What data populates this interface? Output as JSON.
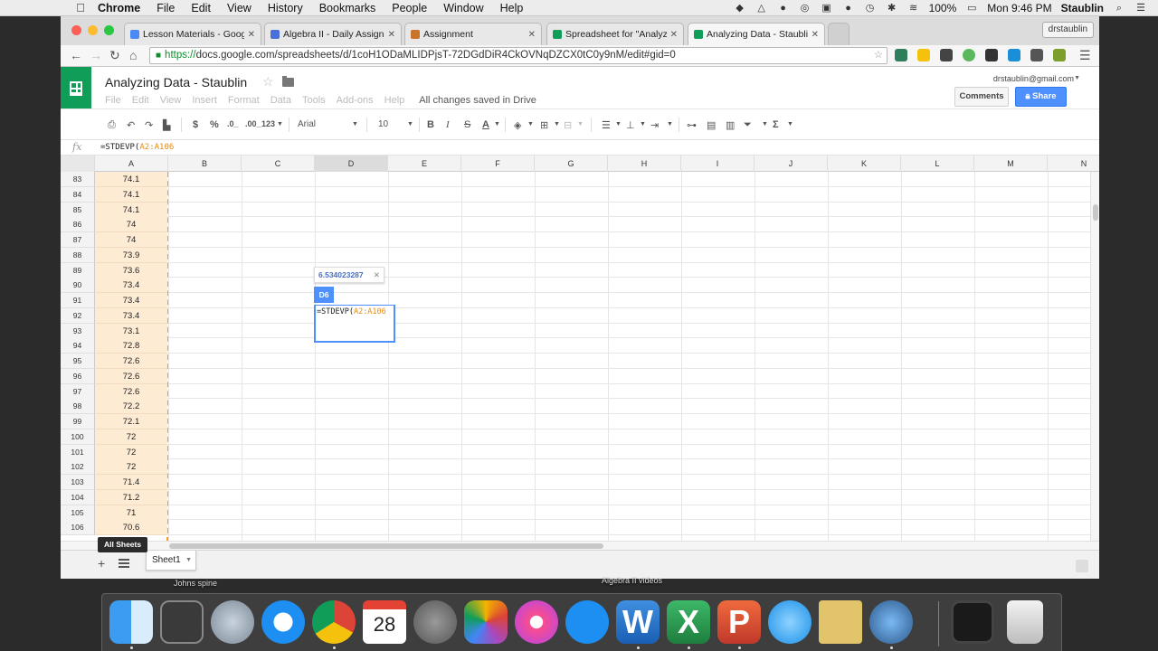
{
  "menubar": {
    "app": "Chrome",
    "items": [
      "File",
      "Edit",
      "View",
      "History",
      "Bookmarks",
      "People",
      "Window",
      "Help"
    ],
    "battery": "100%",
    "clock": "Mon 9:46 PM",
    "user": "Staublin"
  },
  "browser": {
    "tabs": [
      {
        "title": "Lesson Materials - Google",
        "favicon_color": "#4a8af4"
      },
      {
        "title": "Algebra II - Daily Assignme",
        "favicon_color": "#4a6fd8"
      },
      {
        "title": "Assignment",
        "favicon_color": "#c8742a"
      },
      {
        "title": "Spreadsheet for \"Analyzing",
        "favicon_color": "#0f9d58"
      },
      {
        "title": "Analyzing Data - Staublin -",
        "favicon_color": "#0f9d58"
      }
    ],
    "profile": "drstaublin",
    "url_scheme": "https://",
    "url_rest": "docs.google.com/spreadsheets/d/1coH1ODaMLIDPjsT-72DGdDiR4CkOVNqDZCX0tC0y9nM/edit#gid=0"
  },
  "doc": {
    "title": "Analyzing Data - Staublin",
    "menus": [
      "File",
      "Edit",
      "View",
      "Insert",
      "Format",
      "Data",
      "Tools",
      "Add-ons",
      "Help"
    ],
    "save_status": "All changes saved in Drive",
    "account": "drstaublin@gmail.com",
    "comments_label": "Comments",
    "share_label": "Share"
  },
  "toolbar": {
    "currency": "$",
    "percent": "%",
    "dec_less": ".0_",
    "dec_more": ".00_",
    "number_format": "123",
    "font": "Arial",
    "font_size": "10",
    "bold": "B",
    "italic": "I",
    "strike": "S",
    "text_color": "A",
    "functions": "Σ"
  },
  "formula_bar": {
    "fx": "fx",
    "prefix": "=STDEVP(",
    "range": "A2:A106"
  },
  "grid": {
    "columns": [
      "A",
      "B",
      "C",
      "D",
      "E",
      "F",
      "G",
      "H",
      "I",
      "J",
      "K",
      "L",
      "M",
      "N"
    ],
    "selected_column": "D",
    "rows": [
      {
        "n": "83",
        "a": "74.1"
      },
      {
        "n": "84",
        "a": "74.1"
      },
      {
        "n": "85",
        "a": "74.1"
      },
      {
        "n": "86",
        "a": "74"
      },
      {
        "n": "87",
        "a": "74"
      },
      {
        "n": "88",
        "a": "73.9"
      },
      {
        "n": "89",
        "a": "73.6"
      },
      {
        "n": "90",
        "a": "73.4"
      },
      {
        "n": "91",
        "a": "73.4"
      },
      {
        "n": "92",
        "a": "73.4"
      },
      {
        "n": "93",
        "a": "73.1"
      },
      {
        "n": "94",
        "a": "72.8"
      },
      {
        "n": "95",
        "a": "72.6"
      },
      {
        "n": "96",
        "a": "72.6"
      },
      {
        "n": "97",
        "a": "72.6"
      },
      {
        "n": "98",
        "a": "72.2"
      },
      {
        "n": "99",
        "a": "72.1"
      },
      {
        "n": "100",
        "a": "72"
      },
      {
        "n": "101",
        "a": "72"
      },
      {
        "n": "102",
        "a": "72"
      },
      {
        "n": "103",
        "a": "71.4"
      },
      {
        "n": "104",
        "a": "71.2"
      },
      {
        "n": "105",
        "a": "71"
      },
      {
        "n": "106",
        "a": "70.6"
      }
    ],
    "result_preview": "6.534023287",
    "active_cell": "D6",
    "editor_prefix": "=STDEVP(",
    "editor_range": "A2:A106"
  },
  "sheetbar": {
    "tooltip": "All Sheets",
    "sheet_name": "Sheet1"
  },
  "desktop": {
    "label_left": "Johns spine",
    "label_right": "Algebra II videos",
    "calendar_month": "SEP",
    "calendar_day": "28"
  }
}
